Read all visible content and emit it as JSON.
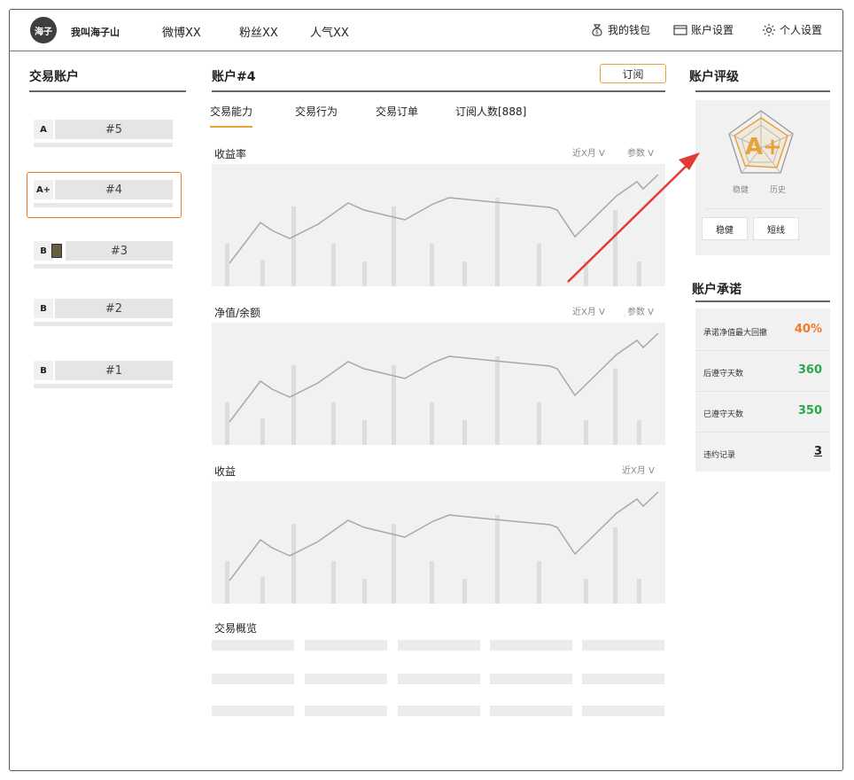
{
  "header": {
    "logo_text": "海子",
    "username": "我叫海子山",
    "social": [
      "微博XX",
      "粉丝XX",
      "人气XX"
    ],
    "wallet": "我的钱包",
    "account_settings": "账户设置",
    "personal_settings": "个人设置"
  },
  "left": {
    "title": "交易账户",
    "accounts": [
      {
        "grade": "A",
        "name": "#5"
      },
      {
        "grade": "A+",
        "name": "#4"
      },
      {
        "grade": "B",
        "name": "#3"
      },
      {
        "grade": "B",
        "name": "#2"
      },
      {
        "grade": "B",
        "name": "#1"
      }
    ]
  },
  "center": {
    "title": "账户#4",
    "subscribe_label": "订阅",
    "tabs": [
      "交易能力",
      "交易行为",
      "交易订单",
      "订阅人数[888]"
    ],
    "charts": [
      {
        "title": "收益率",
        "controls": [
          "近X月 V",
          "参数 V"
        ]
      },
      {
        "title": "净值/余额",
        "controls": [
          "近X月 V",
          "参数 V"
        ]
      },
      {
        "title": "收益",
        "controls": [
          "近X月 V"
        ]
      }
    ],
    "overview_title": "交易概览"
  },
  "right": {
    "rating_title": "账户评级",
    "rating_grade": "A+",
    "radar_labels": [
      "稳健",
      "历史"
    ],
    "rating_buttons": [
      "稳健",
      "短线"
    ],
    "promise_title": "账户承诺",
    "promises": [
      {
        "label": "承诺净值最大回撤",
        "value": "40%",
        "color": "#ef7a24"
      },
      {
        "label": "后遵守天数",
        "value": "360",
        "color": "#2aa84a"
      },
      {
        "label": "已遵守天数",
        "value": "350",
        "color": "#2aa84a"
      },
      {
        "label": "违约记录",
        "value": "3",
        "color": "#222"
      }
    ]
  },
  "colors": {
    "accent": "#e9a23b",
    "selection": "#ef7a24",
    "arrow": "#e53935"
  }
}
